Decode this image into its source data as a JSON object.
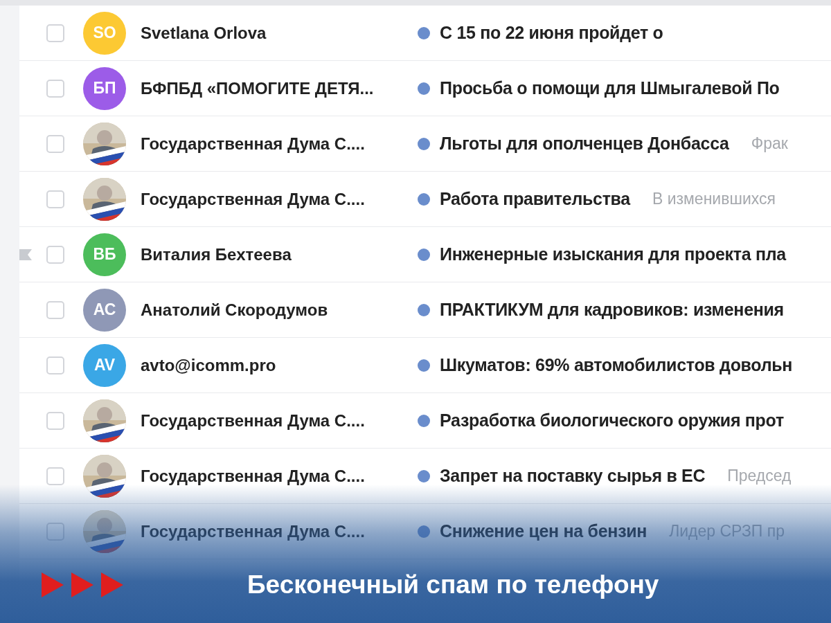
{
  "messages": [
    {
      "sender": "Svetlana Orlova",
      "avatar": {
        "kind": "initials",
        "initials": "SO",
        "color": "#fcc933"
      },
      "subject": "С 15 по 22 июня пройдет о",
      "checked": false,
      "flagged": false
    },
    {
      "sender": "БФПБД «ПОМОГИТЕ ДЕТЯ...",
      "avatar": {
        "kind": "initials",
        "initials": "БП",
        "color": "#9c5ce8"
      },
      "subject": "Просьба о помощи для Шмыгалевой По",
      "checked": false,
      "flagged": false
    },
    {
      "sender": "Государственная Дума С....",
      "subject": "Льготы для ополченцев Донбасса",
      "preview": "Фрак",
      "checked": false,
      "flagged": false
    },
    {
      "sender": "Государственная Дума С....",
      "subject": "Работа правительства",
      "preview": "В изменившихся",
      "checked": false,
      "flagged": false
    },
    {
      "sender": "Виталия Бехтеева",
      "avatar": {
        "kind": "initials",
        "initials": "ВБ",
        "color": "#4cbd5b"
      },
      "subject": "Инженерные изыскания для проекта пла",
      "checked": false,
      "flagged": true
    },
    {
      "sender": "Анатолий Скородумов",
      "avatar": {
        "kind": "initials",
        "initials": "АС",
        "color": "#8f98b6"
      },
      "subject": "ПРАКТИКУМ для кадровиков: изменения",
      "checked": false,
      "flagged": false
    },
    {
      "sender": "avto@icomm.pro",
      "avatar": {
        "kind": "initials",
        "initials": "AV",
        "color": "#3aa7e6"
      },
      "subject": "Шкуматов: 69% автомобилистов довольн",
      "checked": false,
      "flagged": false
    },
    {
      "sender": "Государственная Дума С....",
      "subject": "Разработка биологического оружия прот",
      "checked": false,
      "flagged": false
    },
    {
      "sender": "Государственная Дума С....",
      "subject": "Запрет на поставку сырья в ЕС",
      "preview": "Председ",
      "checked": false,
      "flagged": false
    },
    {
      "sender": "Государственная Дума С....",
      "subject": "Снижение цен на бензин",
      "preview": "Лидер СРЗП пр",
      "checked": false,
      "flagged": false
    }
  ],
  "caption": {
    "text": "Бесконечный спам по телефону"
  }
}
